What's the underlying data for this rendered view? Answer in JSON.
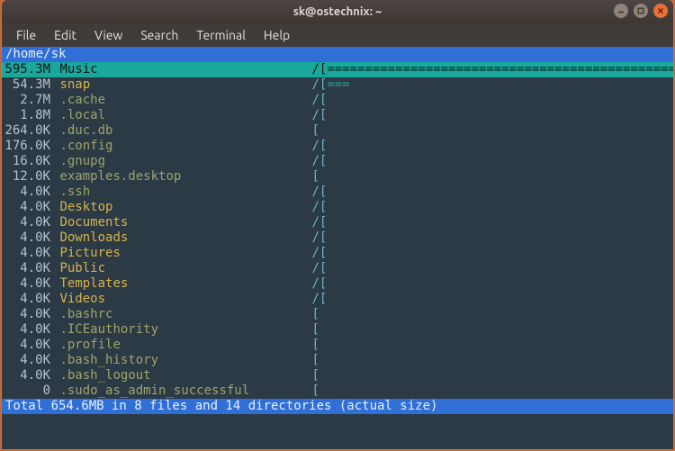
{
  "window": {
    "title": "sk@ostechnix: ~"
  },
  "menu": {
    "items": [
      "File",
      "Edit",
      "View",
      "Search",
      "Terminal",
      "Help"
    ]
  },
  "ui": {
    "path": "/home/sk",
    "footer": "Total 654.6MB in 8 files and 14 directories (actual size)",
    "bar_width_chars": 49,
    "selected_index": 0,
    "entries": [
      {
        "size": "595.3M",
        "name": "Music",
        "type": "dir",
        "fill": 49
      },
      {
        "size": "54.3M",
        "name": "snap",
        "type": "dir",
        "fill": 3
      },
      {
        "size": "2.7M",
        "name": ".cache",
        "type": "ddir",
        "fill": 0
      },
      {
        "size": "1.8M",
        "name": ".local",
        "type": "ddir",
        "fill": 0
      },
      {
        "size": "264.0K",
        "name": ".duc.db",
        "type": "dfile",
        "fill": 0
      },
      {
        "size": "176.0K",
        "name": ".config",
        "type": "ddir",
        "fill": 0
      },
      {
        "size": "16.0K",
        "name": ".gnupg",
        "type": "ddir",
        "fill": 0
      },
      {
        "size": "12.0K",
        "name": "examples.desktop",
        "type": "file",
        "fill": 0
      },
      {
        "size": "4.0K",
        "name": ".ssh",
        "type": "ddir",
        "fill": 0
      },
      {
        "size": "4.0K",
        "name": "Desktop",
        "type": "dir",
        "fill": 0
      },
      {
        "size": "4.0K",
        "name": "Documents",
        "type": "dir",
        "fill": 0
      },
      {
        "size": "4.0K",
        "name": "Downloads",
        "type": "dir",
        "fill": 0
      },
      {
        "size": "4.0K",
        "name": "Pictures",
        "type": "dir",
        "fill": 0
      },
      {
        "size": "4.0K",
        "name": "Public",
        "type": "dir",
        "fill": 0
      },
      {
        "size": "4.0K",
        "name": "Templates",
        "type": "dir",
        "fill": 0
      },
      {
        "size": "4.0K",
        "name": "Videos",
        "type": "dir",
        "fill": 0
      },
      {
        "size": "4.0K",
        "name": ".bashrc",
        "type": "dfile",
        "fill": 0
      },
      {
        "size": "4.0K",
        "name": ".ICEauthority",
        "type": "dfile",
        "fill": 0
      },
      {
        "size": "4.0K",
        "name": ".profile",
        "type": "dfile",
        "fill": 0
      },
      {
        "size": "4.0K",
        "name": ".bash_history",
        "type": "dfile",
        "fill": 0
      },
      {
        "size": "4.0K",
        "name": ".bash_logout",
        "type": "dfile",
        "fill": 0
      },
      {
        "size": "0",
        "name": ".sudo_as_admin_successful",
        "type": "dfile",
        "fill": 0
      }
    ]
  }
}
